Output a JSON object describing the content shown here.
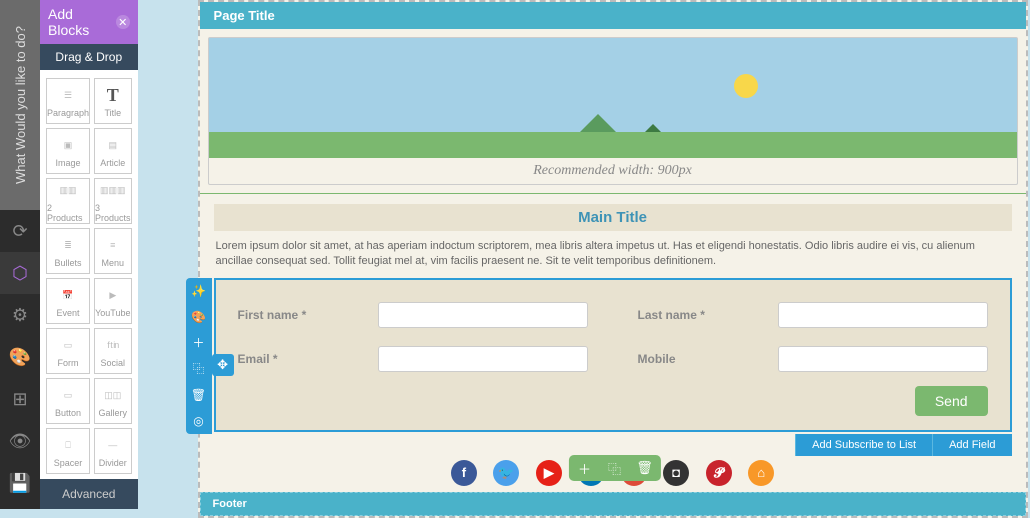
{
  "vnav": {
    "question": "What Would you like to do?"
  },
  "sidebar": {
    "title": "Add Blocks",
    "section_drag": "Drag & Drop",
    "section_advanced": "Advanced",
    "blocks": [
      {
        "label": "Paragraph"
      },
      {
        "label": "Title"
      },
      {
        "label": "Image"
      },
      {
        "label": "Article"
      },
      {
        "label": "2 Products"
      },
      {
        "label": "3 Products"
      },
      {
        "label": "Bullets"
      },
      {
        "label": "Menu"
      },
      {
        "label": "Event"
      },
      {
        "label": "YouTube"
      },
      {
        "label": "Form"
      },
      {
        "label": "Social"
      },
      {
        "label": "Button"
      },
      {
        "label": "Gallery"
      },
      {
        "label": "Spacer"
      },
      {
        "label": "Divider"
      }
    ]
  },
  "page": {
    "title": "Page Title",
    "hero_caption": "Recommended width: 900px",
    "main_title": "Main Title",
    "lorem": "Lorem ipsum dolor sit amet, at has aperiam indoctum scriptorem, mea libris altera impetus ut. Has et eligendi honestatis. Odio libris audire ei vis, cu alienum ancillae consequat sed. Tollit feugiat mel at, vim facilis praesent ne. Sit te velit temporibus definitionem.",
    "footer": "Footer"
  },
  "form": {
    "fields": {
      "first_name": "First name *",
      "last_name": "Last name *",
      "email": "Email *",
      "mobile": "Mobile"
    },
    "send": "Send",
    "actions": {
      "add_list": "Add Subscribe to List",
      "add_field": "Add Field"
    }
  },
  "social": [
    "facebook",
    "twitter",
    "youtube",
    "linkedin",
    "googleplus",
    "instagram",
    "pinterest",
    "home"
  ],
  "colors": {
    "facebook": "#3b5998",
    "twitter": "#4aa0eb",
    "youtube": "#e62117",
    "linkedin": "#0077b5",
    "googleplus": "#dd4b39",
    "instagram": "#333",
    "pinterest": "#c8232c",
    "home": "#f89828"
  }
}
